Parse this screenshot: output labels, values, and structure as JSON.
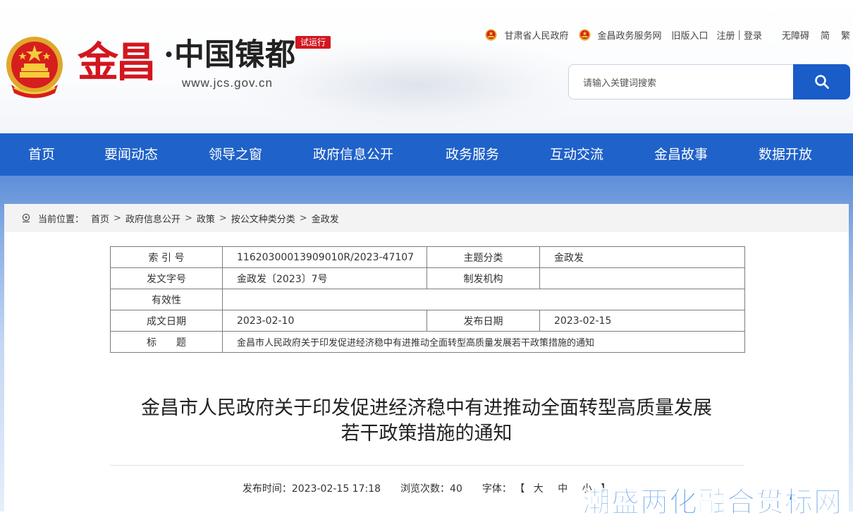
{
  "site": {
    "logo_main": "金昌",
    "logo_sub": "·中国镍都",
    "logo_url": "www.jcs.gov.cn",
    "trial_badge": "试运行"
  },
  "top_links": {
    "province": "甘肃省人民政府",
    "service": "金昌政务服务网",
    "old_version": "旧版入口",
    "register": "注册",
    "separator": "|",
    "login": "登录",
    "accessibility": "无障碍",
    "simplified": "简",
    "traditional": "繁"
  },
  "search": {
    "placeholder": "请输入关键词搜索"
  },
  "nav": [
    "首页",
    "要闻动态",
    "领导之窗",
    "政府信息公开",
    "政务服务",
    "互动交流",
    "金昌故事",
    "数据开放"
  ],
  "breadcrumb": {
    "label": "当前位置：",
    "items": [
      "首页",
      "政府信息公开",
      "政策",
      "按公文种类分类",
      "金政发"
    ],
    "sep": ">"
  },
  "meta": {
    "index_label": "索 引 号",
    "index_value": "11620300013909010R/2023-47107",
    "topic_label": "主题分类",
    "topic_value": "金政发",
    "docno_label": "发文字号",
    "docno_value": "金政发〔2023〕7号",
    "issuer_label": "制发机构",
    "issuer_value": "",
    "validity_label": "有效性",
    "validity_value": "",
    "created_label": "成文日期",
    "created_value": "2023-02-10",
    "published_label": "发布日期",
    "published_value": "2023-02-15",
    "title_label": "标　　题",
    "title_value": "金昌市人民政府关于印发促进经济稳中有进推动全面转型高质量发展若干政策措施的通知"
  },
  "article": {
    "title_line1": "金昌市人民政府关于印发促进经济稳中有进推动全面转型高质量发展",
    "title_line2": "若干政策措施的通知",
    "publish_label": "发布时间：",
    "publish_time": "2023-02-15 17:18",
    "views_label": "浏览次数：",
    "views": "40",
    "font_label": "字体：",
    "bracket_open": "【",
    "font_large": "大",
    "font_medium": "中",
    "font_small": "小",
    "bracket_close": "】"
  },
  "watermark": "潮盛两化融合贯标网",
  "colors": {
    "nav_blue": "#1f62c9",
    "search_blue": "#1a5cc8",
    "brand_red": "#d2171f"
  }
}
